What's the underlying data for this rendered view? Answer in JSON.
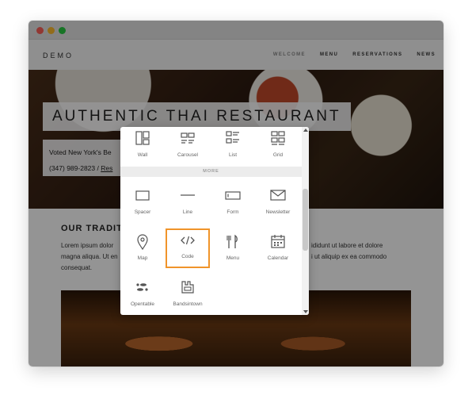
{
  "browser": {
    "traffic_lights": [
      "close",
      "minimize",
      "maximize"
    ]
  },
  "site": {
    "logo": "DEMO",
    "nav": [
      "WELCOME",
      "MENU",
      "RESERVATIONS",
      "NEWS"
    ],
    "hero_title": "AUTHENTIC THAI RESTAURANT",
    "hero_line1": "Voted New York's Be",
    "hero_phone": "(347) 989-2823 / ",
    "hero_link": "Res",
    "section_title": "OUR TRADIT",
    "para_left_1": "Lorem ipsum dolor",
    "para_left_2": "magna aliqua. Ut en",
    "para_left_3": "consequat.",
    "para_right_1": "ididunt ut labore et dolore",
    "para_right_2": "i ut aliquip ex ea commodo"
  },
  "picker": {
    "top_row": [
      {
        "label": "Wall",
        "icon": "wall-icon"
      },
      {
        "label": "Carousel",
        "icon": "carousel-icon"
      },
      {
        "label": "List",
        "icon": "list-icon"
      },
      {
        "label": "Grid",
        "icon": "grid-icon"
      }
    ],
    "section_label": "MORE",
    "more": [
      {
        "label": "Spacer",
        "icon": "spacer-icon"
      },
      {
        "label": "Line",
        "icon": "line-icon"
      },
      {
        "label": "Form",
        "icon": "form-icon"
      },
      {
        "label": "Newsletter",
        "icon": "newsletter-icon"
      },
      {
        "label": "Map",
        "icon": "map-pin-icon"
      },
      {
        "label": "Code",
        "icon": "code-icon"
      },
      {
        "label": "Menu",
        "icon": "menu-fork-knife-icon"
      },
      {
        "label": "Calendar",
        "icon": "calendar-icon"
      },
      {
        "label": "Opentable",
        "icon": "opentable-icon"
      },
      {
        "label": "Bandsintown",
        "icon": "bandsintown-icon"
      }
    ],
    "highlighted": "Code",
    "highlight_color": "#f0942a"
  }
}
